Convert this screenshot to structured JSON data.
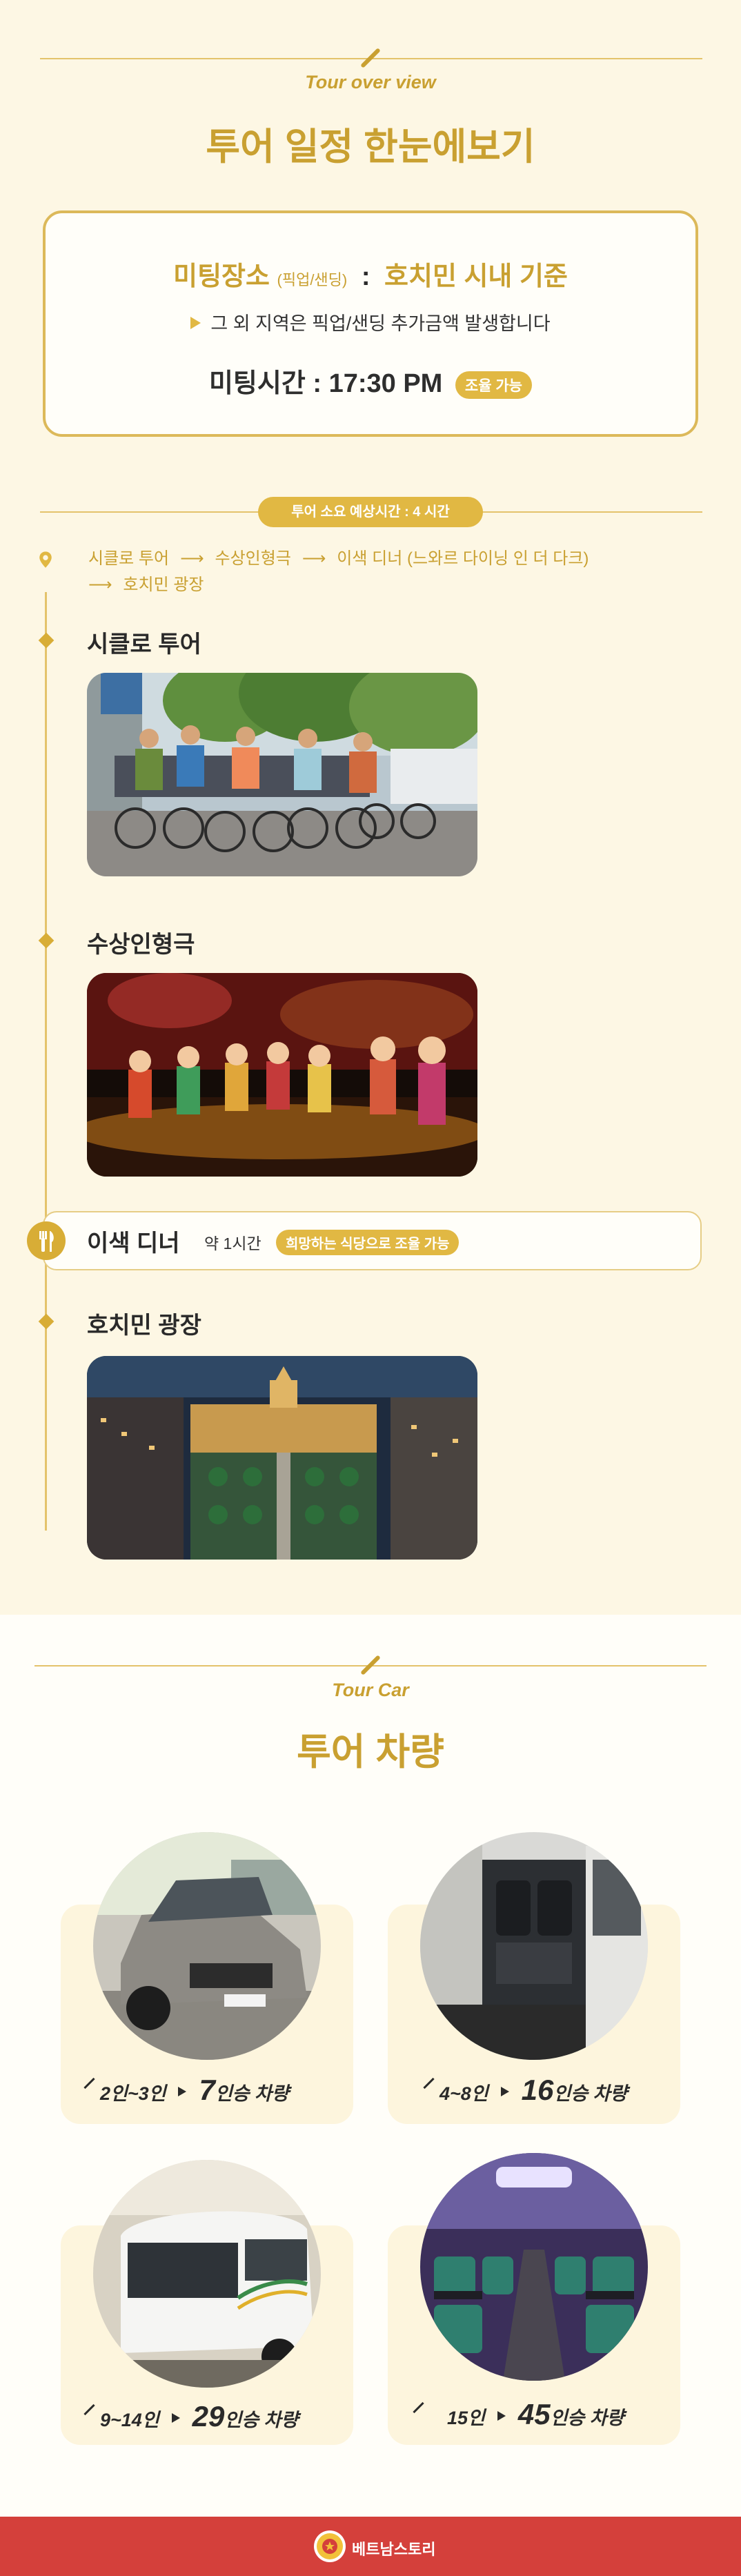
{
  "overview": {
    "eyebrow": "Tour over view",
    "title": "투어 일정 한눈에보기",
    "meeting": {
      "place_label": "미팅장소",
      "place_sub": "(픽업/샌딩)",
      "separator": ":",
      "place_value": "호치민 시내 기준",
      "note": "그 외 지역은 픽업/샌딩 추가금액 발생합니다",
      "time_label": "미팅시간 : 17:30 PM",
      "time_badge": "조율 가능"
    },
    "duration_badge": "투어 소요 예상시간 : 4 시간",
    "route": [
      "시클로 투어",
      "수상인형극",
      "이색 디너 (느와르 다이닝 인 더 다크)",
      "호치민 광장"
    ],
    "route_arrow": "⟶",
    "stops": [
      {
        "title": "시클로 투어"
      },
      {
        "title": "수상인형극"
      },
      {
        "title": "이색 디너",
        "duration": "약 1시간",
        "badge": "희망하는 식당으로 조율 가능"
      },
      {
        "title": "호치민 광장"
      }
    ]
  },
  "cars": {
    "eyebrow": "Tour Car",
    "title": "투어 차량",
    "items": [
      {
        "people": "2인~3인",
        "seats": "7",
        "seats_suffix": "인승 차량"
      },
      {
        "people": "4~8인",
        "seats": "16",
        "seats_suffix": "인승 차량"
      },
      {
        "people": "9~14인",
        "seats": "29",
        "seats_suffix": "인승 차량"
      },
      {
        "people": "15인",
        "seats": "45",
        "seats_suffix": "인승 차량"
      }
    ]
  },
  "footer": {
    "brand": "베트남스토리"
  },
  "colors": {
    "accent": "#c9a031",
    "cream": "#fdf7e4",
    "footer": "#d4403b"
  }
}
